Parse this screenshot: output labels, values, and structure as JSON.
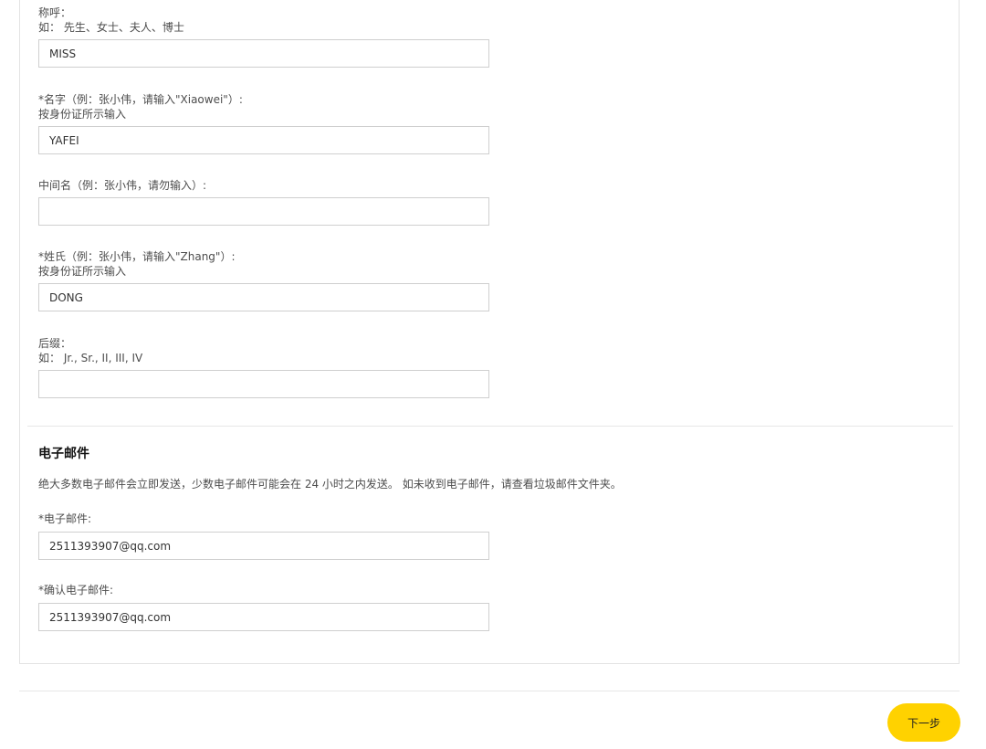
{
  "form": {
    "salutation": {
      "label": "称呼：",
      "hint": "如： 先生、女士、夫人、博士",
      "value": "MISS"
    },
    "first_name": {
      "label": "*名字（例：张小伟，请输入\"Xiaowei\"）:",
      "hint": "按身份证所示输入",
      "value": "YAFEI"
    },
    "middle_name": {
      "label": "中间名（例：张小伟，请勿输入）:",
      "value": ""
    },
    "last_name": {
      "label": "*姓氏（例：张小伟，请输入\"Zhang\"）:",
      "hint": "按身份证所示输入",
      "value": "DONG"
    },
    "suffix": {
      "label": "后缀：",
      "hint": "如： Jr., Sr., II, III, IV",
      "value": ""
    }
  },
  "email_section": {
    "title": "电子邮件",
    "description": "绝大多数电子邮件会立即发送，少数电子邮件可能会在 24 小时之内发送。 如未收到电子邮件，请查看垃圾邮件文件夹。",
    "email": {
      "label": "*电子邮件:",
      "value": "2511393907@qq.com"
    },
    "confirm_email": {
      "label": "*确认电子邮件:",
      "value": "2511393907@qq.com"
    }
  },
  "actions": {
    "next_label": "下一步"
  },
  "colors": {
    "accent": "#ffd200",
    "border": "#cfcfcf"
  }
}
